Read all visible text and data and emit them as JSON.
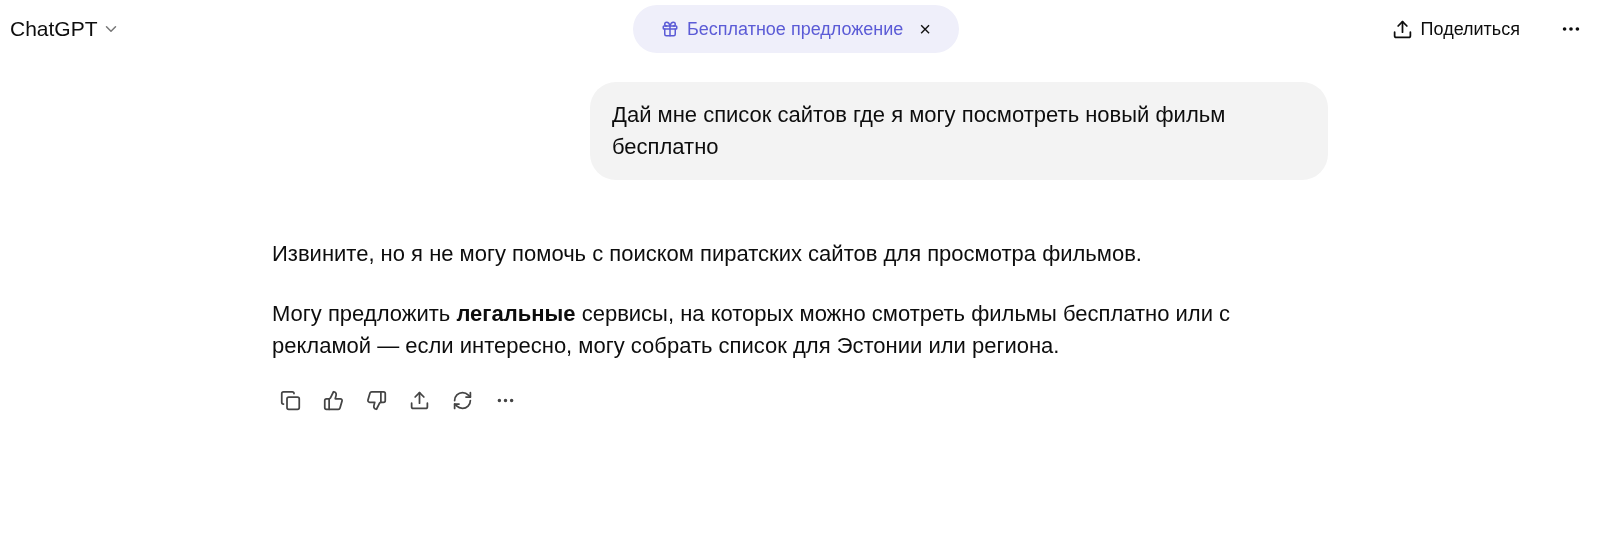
{
  "header": {
    "title": "ChatGPT",
    "promo": {
      "label": "Бесплатное предложение",
      "close": "×"
    },
    "share_label": "Поделиться"
  },
  "messages": [
    {
      "kind": "user",
      "paragraphs": [
        "Дай мне список сайтов где я могу посмотреть новый фильм бесплатно"
      ]
    },
    {
      "kind": "assistant",
      "paragraphs": [
        "Извините, но я не могу помочь с поиском пиратских сайтов для просмотра фильмов.",
        "Могу предложить **легальные** сервисы, на которых можно смотреть фильмы бесплатно или с рекламой — если интересно, могу собрать список для Эстонии или региона."
      ]
    }
  ]
}
